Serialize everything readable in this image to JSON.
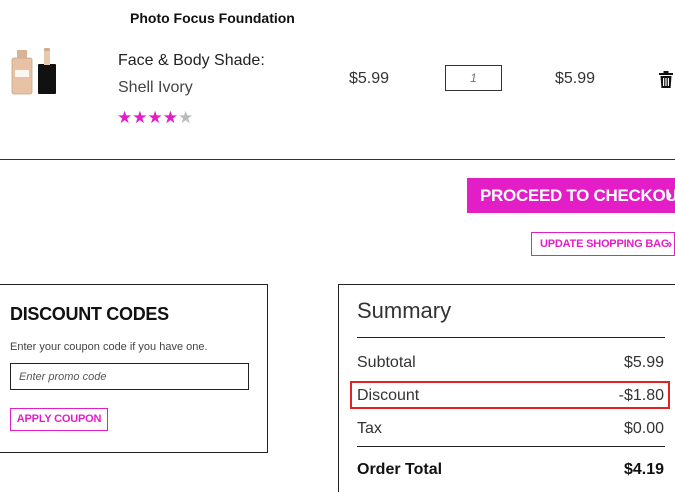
{
  "product": {
    "name": "Photo Focus Foundation",
    "variant_label": "Face & Body Shade:",
    "variant_value": "Shell Ivory",
    "rating": 4,
    "rating_max": 5,
    "unit_price": "$5.99",
    "quantity": "1",
    "line_total": "$5.99"
  },
  "actions": {
    "checkout_label": "PROCEED TO CHECKOUT",
    "update_label": "UPDATE SHOPPING BAG"
  },
  "discount": {
    "title": "DISCOUNT CODES",
    "hint": "Enter your coupon code if you have one.",
    "placeholder": "Enter promo code",
    "apply_label": "APPLY COUPON"
  },
  "summary": {
    "title": "Summary",
    "subtotal_label": "Subtotal",
    "subtotal_value": "$5.99",
    "discount_label": "Discount",
    "discount_value": "-$1.80",
    "tax_label": "Tax",
    "tax_value": "$0.00",
    "total_label": "Order Total",
    "total_value": "$4.19"
  },
  "colors": {
    "accent": "#e41ec7",
    "highlight": "#e02424"
  },
  "icons": {
    "chevron": "chevron-right-icon",
    "delete": "trash-icon"
  }
}
